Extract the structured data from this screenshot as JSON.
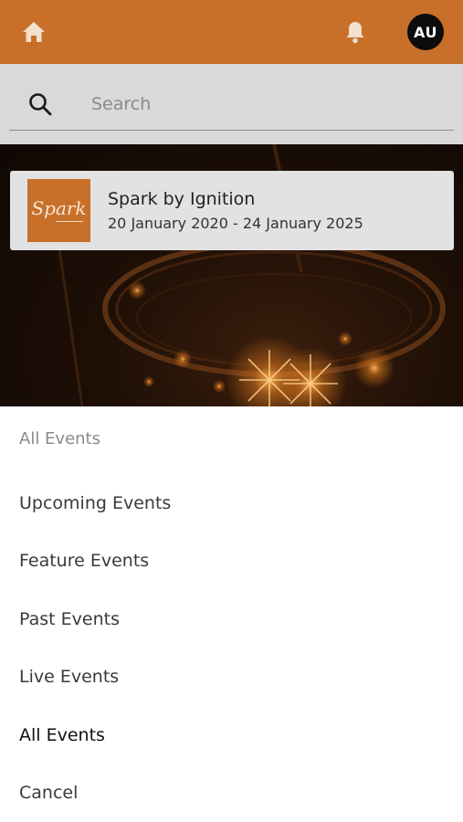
{
  "header": {
    "home_icon": "home-icon",
    "bell_icon": "bell-icon",
    "avatar_initials": "AU",
    "bar_color": "#c8702a"
  },
  "search": {
    "icon": "search-icon",
    "placeholder": "Search",
    "value": ""
  },
  "event": {
    "logo_text": "Spark",
    "title": "Spark by Ignition",
    "dates": "20 January 2020 - 24 January 2025"
  },
  "filter_sheet": {
    "title": "All Events",
    "options": [
      {
        "label": "Upcoming Events"
      },
      {
        "label": "Feature Events"
      },
      {
        "label": "Past Events"
      },
      {
        "label": "Live Events"
      },
      {
        "label": "All Events"
      }
    ],
    "selected": "All Events",
    "cancel_label": "Cancel"
  }
}
